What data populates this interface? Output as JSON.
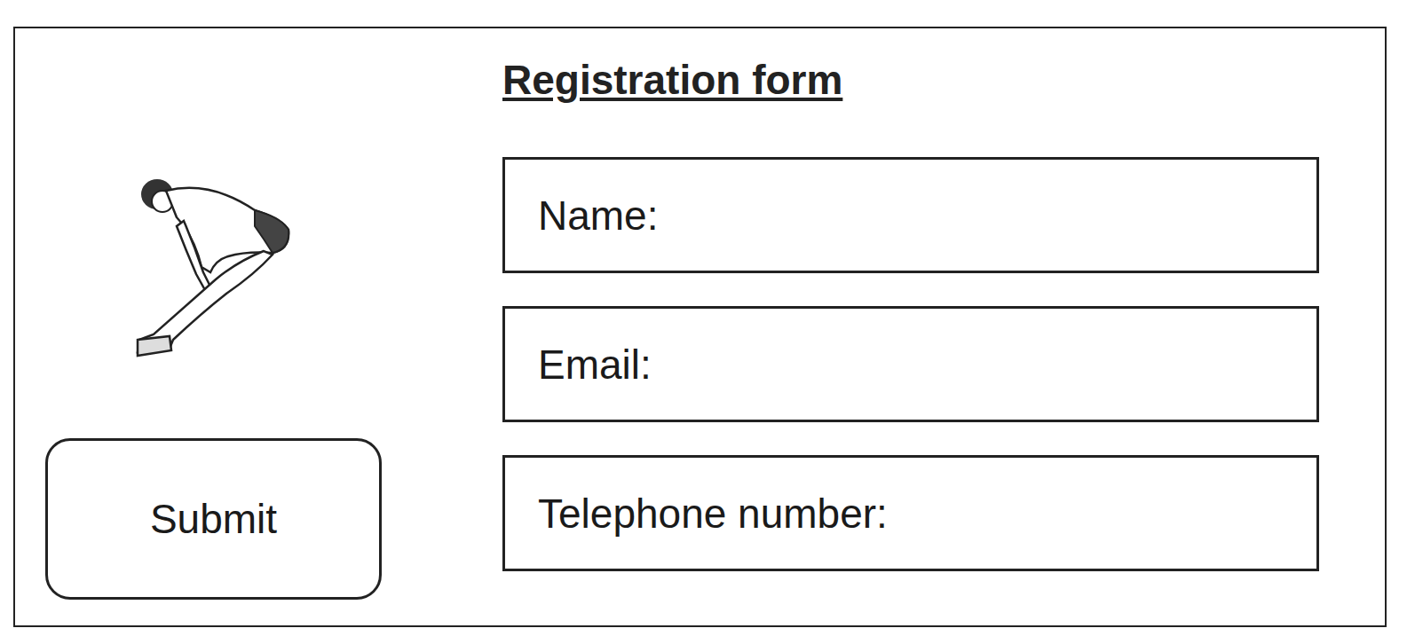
{
  "form": {
    "title": "Registration form",
    "fields": [
      {
        "label": "Name:"
      },
      {
        "label": "Email:"
      },
      {
        "label": "Telephone number:"
      }
    ],
    "submit": "Submit"
  }
}
